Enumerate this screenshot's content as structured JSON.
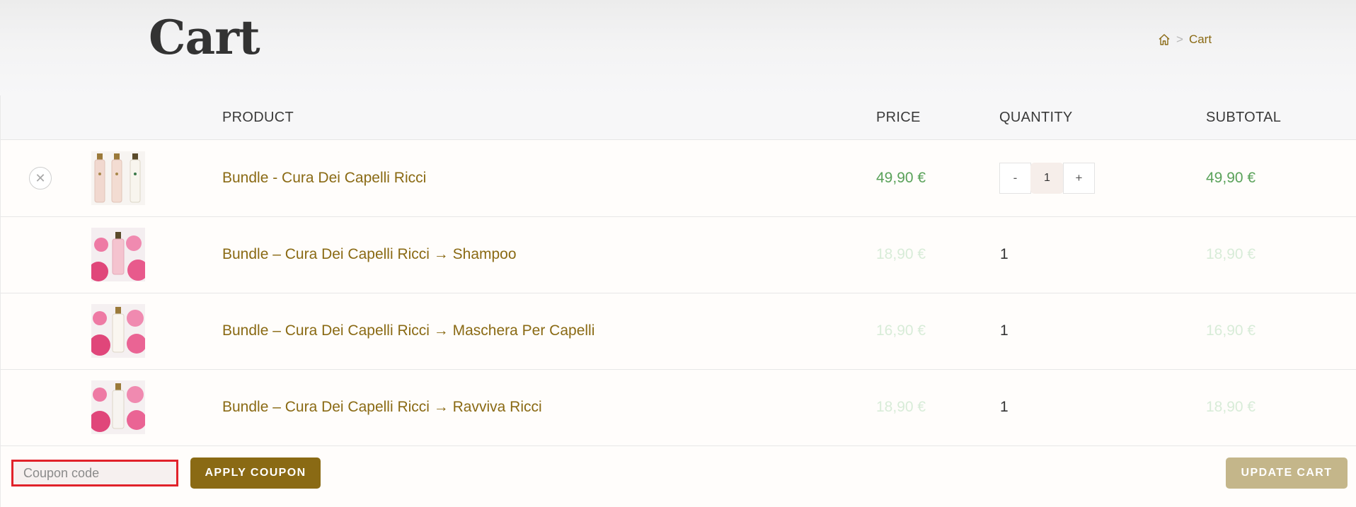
{
  "header": {
    "title": "Cart",
    "breadcrumb": {
      "home_icon": "home-icon",
      "separator": ">",
      "current": "Cart"
    }
  },
  "table": {
    "columns": [
      "PRODUCT",
      "PRICE",
      "QUANTITY",
      "SUBTOTAL"
    ],
    "rows": [
      {
        "name": "Bundle - Cura Dei Capelli Ricci",
        "price": "49,90 €",
        "quantity": "1",
        "subtotal": "49,90 €"
      },
      {
        "name": "Bundle – Cura Dei Capelli Ricci → Shampoo",
        "price": "18,90 €",
        "quantity": "1",
        "subtotal": "18,90 €"
      },
      {
        "name": "Bundle – Cura Dei Capelli Ricci → Maschera Per Capelli",
        "price": "16,90 €",
        "quantity": "1",
        "subtotal": "16,90 €"
      },
      {
        "name": "Bundle – Cura Dei Capelli Ricci → Ravviva Ricci",
        "price": "18,90 €",
        "quantity": "1",
        "subtotal": "18,90 €"
      }
    ],
    "remove_symbol": "✕",
    "qty_minus": "-",
    "qty_plus": "+"
  },
  "coupon": {
    "placeholder": "Coupon code",
    "apply_label": "APPLY COUPON"
  },
  "update_label": "UPDATE CART",
  "colors": {
    "accent": "#8a6a14",
    "price_green": "#5aa25a",
    "price_faded": "#d8ecd8",
    "highlight_border": "#e1222a",
    "update_button": "#c4b68a"
  }
}
